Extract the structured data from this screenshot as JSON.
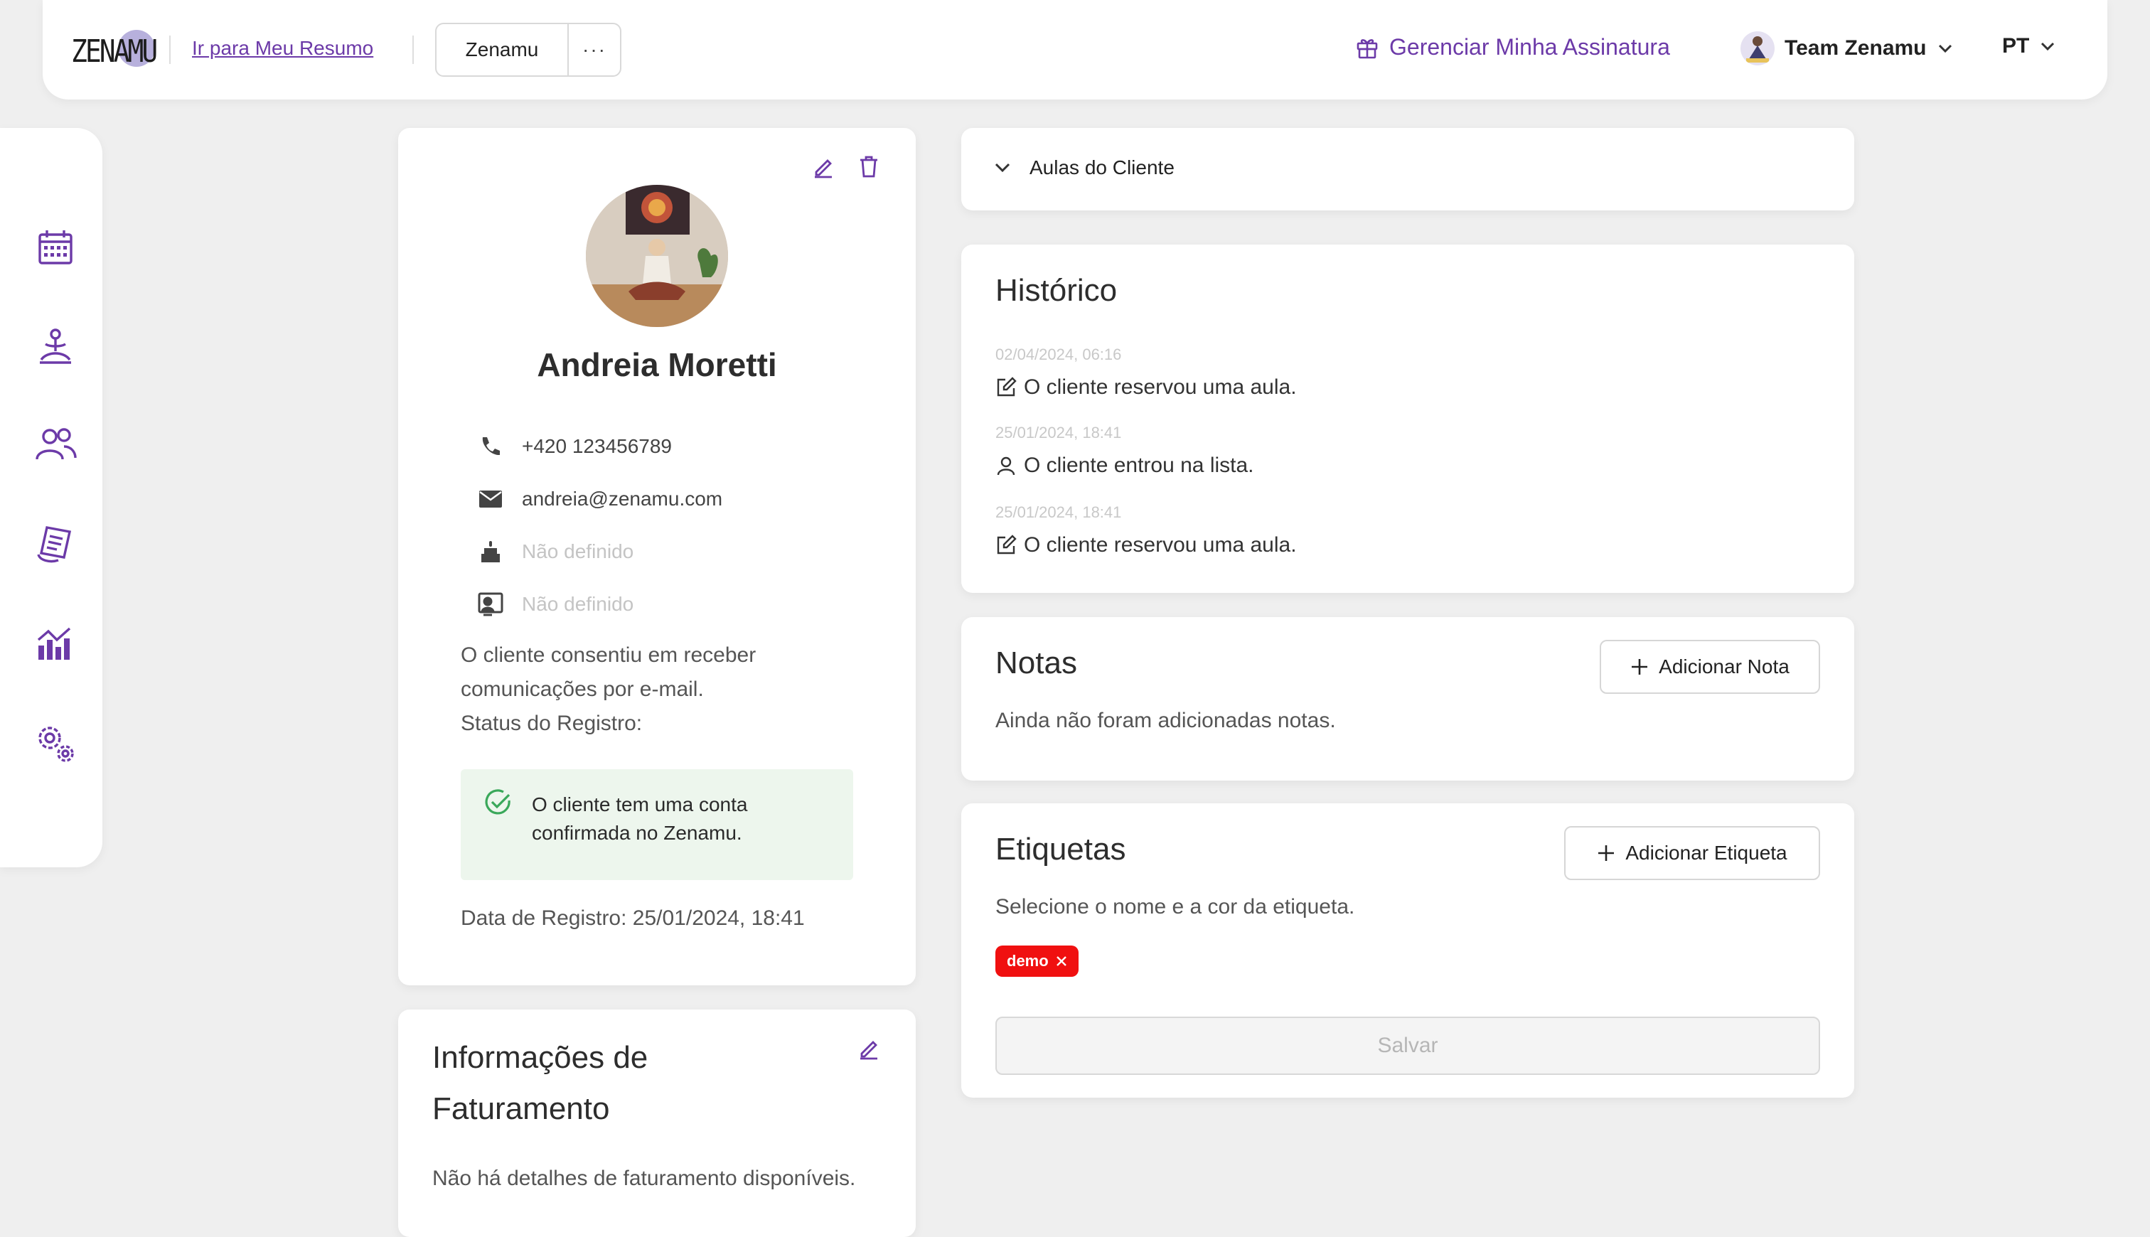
{
  "header": {
    "logo_text": "ZENAMU",
    "summary_link": "Ir para Meu Resumo",
    "studio_button": "Zenamu",
    "more_button": "···",
    "manage_subscription": "Gerenciar Minha Assinatura",
    "team_name": "Team Zenamu",
    "language": "PT"
  },
  "sidebar": {
    "items": [
      {
        "icon": "calendar-icon"
      },
      {
        "icon": "yoga-icon"
      },
      {
        "icon": "users-icon"
      },
      {
        "icon": "invoice-icon"
      },
      {
        "icon": "analytics-icon"
      },
      {
        "icon": "settings-icon"
      }
    ]
  },
  "profile": {
    "name": "Andreia Moretti",
    "phone": "+420 123456789",
    "email": "andreia@zenamu.com",
    "birthday": "Não definido",
    "id_document": "Não definido",
    "consent_text": "O cliente consentiu em receber comunicações por e-mail.",
    "registration_status_label": "Status do Registro:",
    "status_message": "O cliente tem uma conta confirmada no Zenamu.",
    "registration_date": "Data de Registro: 25/01/2024, 18:41"
  },
  "billing": {
    "title": "Informações de Faturamento",
    "empty_text": "Não há detalhes de faturamento disponíveis."
  },
  "classes": {
    "title": "Aulas do Cliente"
  },
  "history": {
    "title": "Histórico",
    "entries": [
      {
        "date": "02/04/2024, 06:16",
        "text": "O cliente reservou uma aula.",
        "icon": "edit-icon"
      },
      {
        "date": "25/01/2024, 18:41",
        "text": "O cliente entrou na lista.",
        "icon": "user-icon"
      },
      {
        "date": "25/01/2024, 18:41",
        "text": "O cliente reservou uma aula.",
        "icon": "edit-icon"
      }
    ]
  },
  "notes": {
    "title": "Notas",
    "add_button": "Adicionar Nota",
    "empty_text": "Ainda não foram adicionadas notas."
  },
  "tags": {
    "title": "Etiquetas",
    "add_button": "Adicionar Etiqueta",
    "hint": "Selecione o nome e a cor da etiqueta.",
    "items": [
      {
        "label": "demo",
        "color": "#f01010"
      }
    ],
    "save_button": "Salvar"
  },
  "colors": {
    "accent": "#6c3aa8",
    "success": "#3aa85a",
    "tag_red": "#f01010"
  }
}
